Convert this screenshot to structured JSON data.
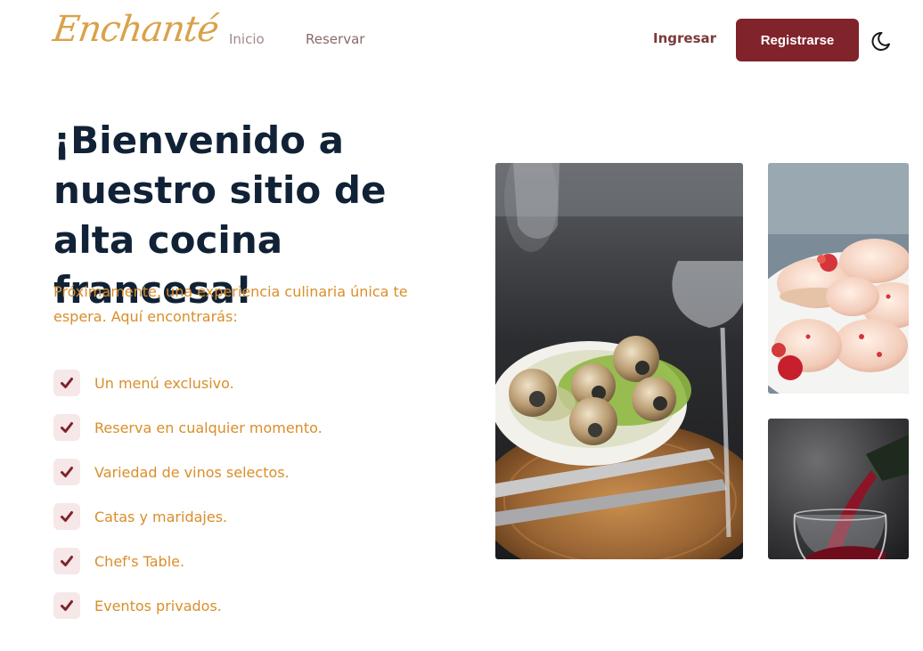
{
  "header": {
    "logo_text": "Enchanté",
    "nav": [
      {
        "label": "Inicio"
      },
      {
        "label": "Reservar"
      }
    ],
    "login_label": "Ingresar",
    "register_label": "Registrarse",
    "theme_icon": "moon-icon"
  },
  "hero": {
    "title": "¡Bienvenido a nuestro sitio de alta cocina francesa!",
    "subtitle": "Próximamente, una experiencia culinaria única te espera. Aquí encontrarás:",
    "features": [
      {
        "text": "Un menú exclusivo."
      },
      {
        "text": "Reserva en cualquier momento."
      },
      {
        "text": "Variedad de vinos selectos."
      },
      {
        "text": "Catas y maridajes."
      },
      {
        "text": "Chef's Table."
      },
      {
        "text": "Eventos privados."
      }
    ]
  },
  "colors": {
    "brand": "#80232a",
    "heading": "#112236",
    "accent_text": "#d98e2a",
    "check_bg": "#f6e7e8"
  }
}
